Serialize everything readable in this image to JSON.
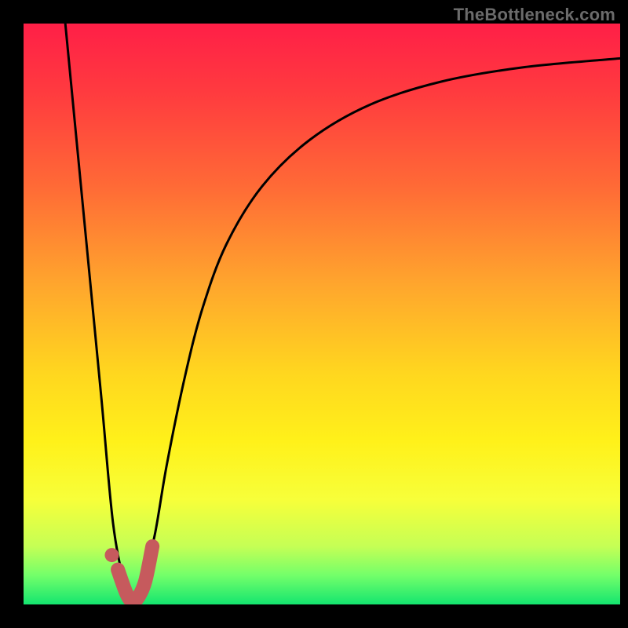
{
  "watermark": "TheBottleneck.com",
  "colors": {
    "frame": "#000000",
    "curve": "#000000",
    "marker_stroke": "#c65a5d",
    "marker_fill": "#c65a5d",
    "gradient_stops": [
      {
        "offset": 0.0,
        "color": "#ff1f47"
      },
      {
        "offset": 0.12,
        "color": "#ff3b3f"
      },
      {
        "offset": 0.28,
        "color": "#ff6a36"
      },
      {
        "offset": 0.45,
        "color": "#ffa62d"
      },
      {
        "offset": 0.6,
        "color": "#ffd61f"
      },
      {
        "offset": 0.72,
        "color": "#fff11a"
      },
      {
        "offset": 0.82,
        "color": "#f7ff3a"
      },
      {
        "offset": 0.9,
        "color": "#c5ff55"
      },
      {
        "offset": 0.95,
        "color": "#73ff6a"
      },
      {
        "offset": 1.0,
        "color": "#14e56f"
      }
    ]
  },
  "chart_data": {
    "type": "line",
    "title": "",
    "xlabel": "",
    "ylabel": "",
    "xlim": [
      0,
      100
    ],
    "ylim": [
      0,
      100
    ],
    "grid": false,
    "legend": false,
    "annotations": [
      "TheBottleneck.com"
    ],
    "series": [
      {
        "name": "bottleneck-curve",
        "x": [
          7,
          10,
          13,
          15,
          17,
          18,
          19,
          20,
          22,
          24,
          27,
          30,
          34,
          40,
          48,
          58,
          70,
          84,
          100
        ],
        "y": [
          100,
          68,
          36,
          14,
          3,
          0,
          1,
          4,
          12,
          24,
          39,
          51,
          62,
          72,
          80,
          86,
          90,
          92.5,
          94
        ]
      }
    ],
    "markers": [
      {
        "name": "highlight-hook",
        "type": "polyline",
        "x": [
          15.8,
          17.2,
          18.2,
          19.2,
          20.4,
          21.6
        ],
        "y": [
          6.0,
          2.0,
          0.5,
          1.2,
          4.0,
          10.0
        ]
      },
      {
        "name": "highlight-dot",
        "type": "point",
        "x": 14.8,
        "y": 8.5
      }
    ]
  }
}
